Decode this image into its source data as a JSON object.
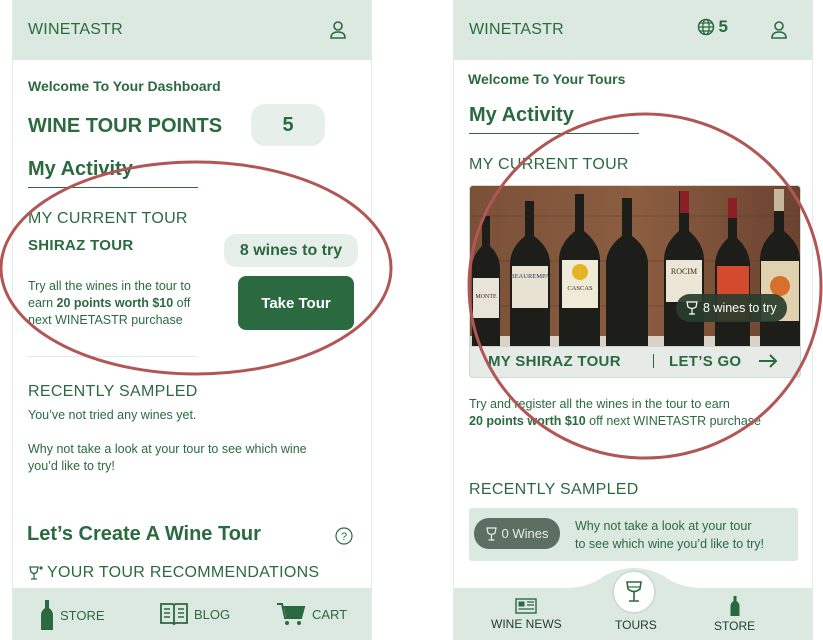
{
  "colors": {
    "brand_green": "#2b6a40",
    "header_bg": "#dbe9e1",
    "annotation_red": "#b25555"
  },
  "left": {
    "header": {
      "brand": "WINETASTR",
      "icons": [
        "user-icon"
      ]
    },
    "welcome": "Welcome To Your Dashboard",
    "points": {
      "label": "WINE TOUR POINTS",
      "value": "5"
    },
    "activity_title": "My Activity",
    "current_tour": {
      "section_label": "MY CURRENT TOUR",
      "tour_name": "SHIRAZ TOUR",
      "wines_badge": "8 wines to try",
      "desc_line1": "Try all the wines in the tour to",
      "desc_line2_pre": "earn ",
      "desc_line2_bold": "20 points worth $10",
      "desc_line2_post": " off",
      "desc_line3": "next WINETASTR purchase",
      "button": "Take Tour"
    },
    "recently_sampled": {
      "title": "RECENTLY SAMPLED",
      "empty": "You’ve not tried any wines yet.",
      "prompt_line1": "Why not take a look at your tour to see which wine",
      "prompt_line2": "you’d like to try!"
    },
    "create_tour": {
      "title": "Let’s Create A Wine Tour",
      "recommendations": "YOUR TOUR RECOMMENDATIONS"
    },
    "nav": [
      {
        "label": "STORE",
        "icon": "bottle-icon"
      },
      {
        "label": "BLOG",
        "icon": "book-icon"
      },
      {
        "label": "CART",
        "icon": "cart-icon"
      }
    ]
  },
  "right": {
    "header": {
      "brand": "WINETASTR",
      "globe_count": "5",
      "icons": [
        "globe-icon",
        "user-icon"
      ]
    },
    "welcome": "Welcome To Your Tours",
    "activity_title": "My Activity",
    "current_tour": {
      "section_label": "MY CURRENT TOUR",
      "card_title": "MY SHIRAZ TOUR",
      "card_action": "LET’S GO",
      "wines_pill": "8 wines to try",
      "bottle_labels": [
        "MONTE",
        "BEAUREMPA",
        "CASCAS",
        "ROCIM"
      ],
      "desc_line1": "Try and register all the wines in the tour to earn",
      "desc_line2_bold": "20 points worth $10",
      "desc_line2_post": " off next WINETASTR purchase"
    },
    "recently_sampled": {
      "title": "RECENTLY SAMPLED",
      "pill": "0 Wines",
      "prompt_line1": "Why not take a look at your tour",
      "prompt_line2": "to see which wine you’d like to try!"
    },
    "nav": [
      {
        "label": "WINE NEWS",
        "icon": "newspaper-icon"
      },
      {
        "label": "TOURS",
        "icon": "wine-glass-icon"
      },
      {
        "label": "STORE",
        "icon": "bottle-icon"
      }
    ]
  }
}
